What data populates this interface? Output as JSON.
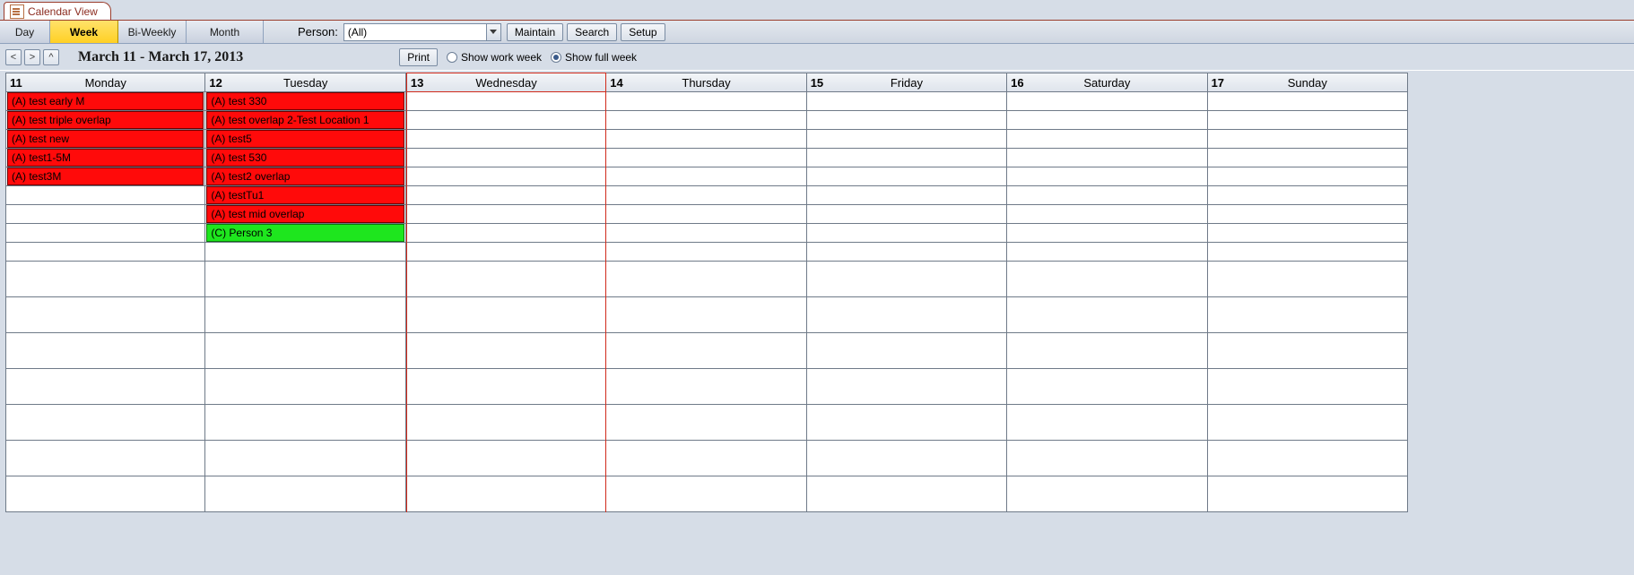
{
  "tab": {
    "title": "Calendar View"
  },
  "view_tabs": {
    "day": "Day",
    "week": "Week",
    "biweekly": "Bi-Weekly",
    "month": "Month",
    "active": "week"
  },
  "person": {
    "label": "Person:",
    "value": "(All)"
  },
  "buttons": {
    "maintain": "Maintain",
    "search": "Search",
    "setup": "Setup",
    "print": "Print"
  },
  "nav": {
    "prev": "<",
    "next": ">",
    "up": "^"
  },
  "date_range": "March 11 - March 17, 2013",
  "week_mode": {
    "work_label": "Show work week",
    "full_label": "Show full week",
    "selected": "full"
  },
  "days": [
    {
      "num": "11",
      "name": "Monday"
    },
    {
      "num": "12",
      "name": "Tuesday"
    },
    {
      "num": "13",
      "name": "Wednesday"
    },
    {
      "num": "14",
      "name": "Thursday"
    },
    {
      "num": "15",
      "name": "Friday"
    },
    {
      "num": "16",
      "name": "Saturday"
    },
    {
      "num": "17",
      "name": "Sunday"
    }
  ],
  "today_index": 2,
  "appointments": {
    "monday": [
      {
        "text": "(A) test early M",
        "color": "red"
      },
      {
        "text": "(A) test triple overlap",
        "color": "red"
      },
      {
        "text": "(A) test new",
        "color": "red"
      },
      {
        "text": "(A) test1-5M",
        "color": "red"
      },
      {
        "text": "(A) test3M",
        "color": "red"
      }
    ],
    "tuesday": [
      {
        "text": "(A) test 330",
        "color": "red"
      },
      {
        "text": "(A) test overlap 2-Test Location 1",
        "color": "red"
      },
      {
        "text": "(A) test5",
        "color": "red"
      },
      {
        "text": "(A) test 530",
        "color": "red"
      },
      {
        "text": "(A) test2 overlap",
        "color": "red"
      },
      {
        "text": "(A) testTu1",
        "color": "red"
      },
      {
        "text": "(A) test mid overlap",
        "color": "red"
      },
      {
        "text": "(C) Person 3",
        "color": "green"
      }
    ]
  },
  "grid": {
    "event_rows": 9,
    "tall_rows": 7
  }
}
